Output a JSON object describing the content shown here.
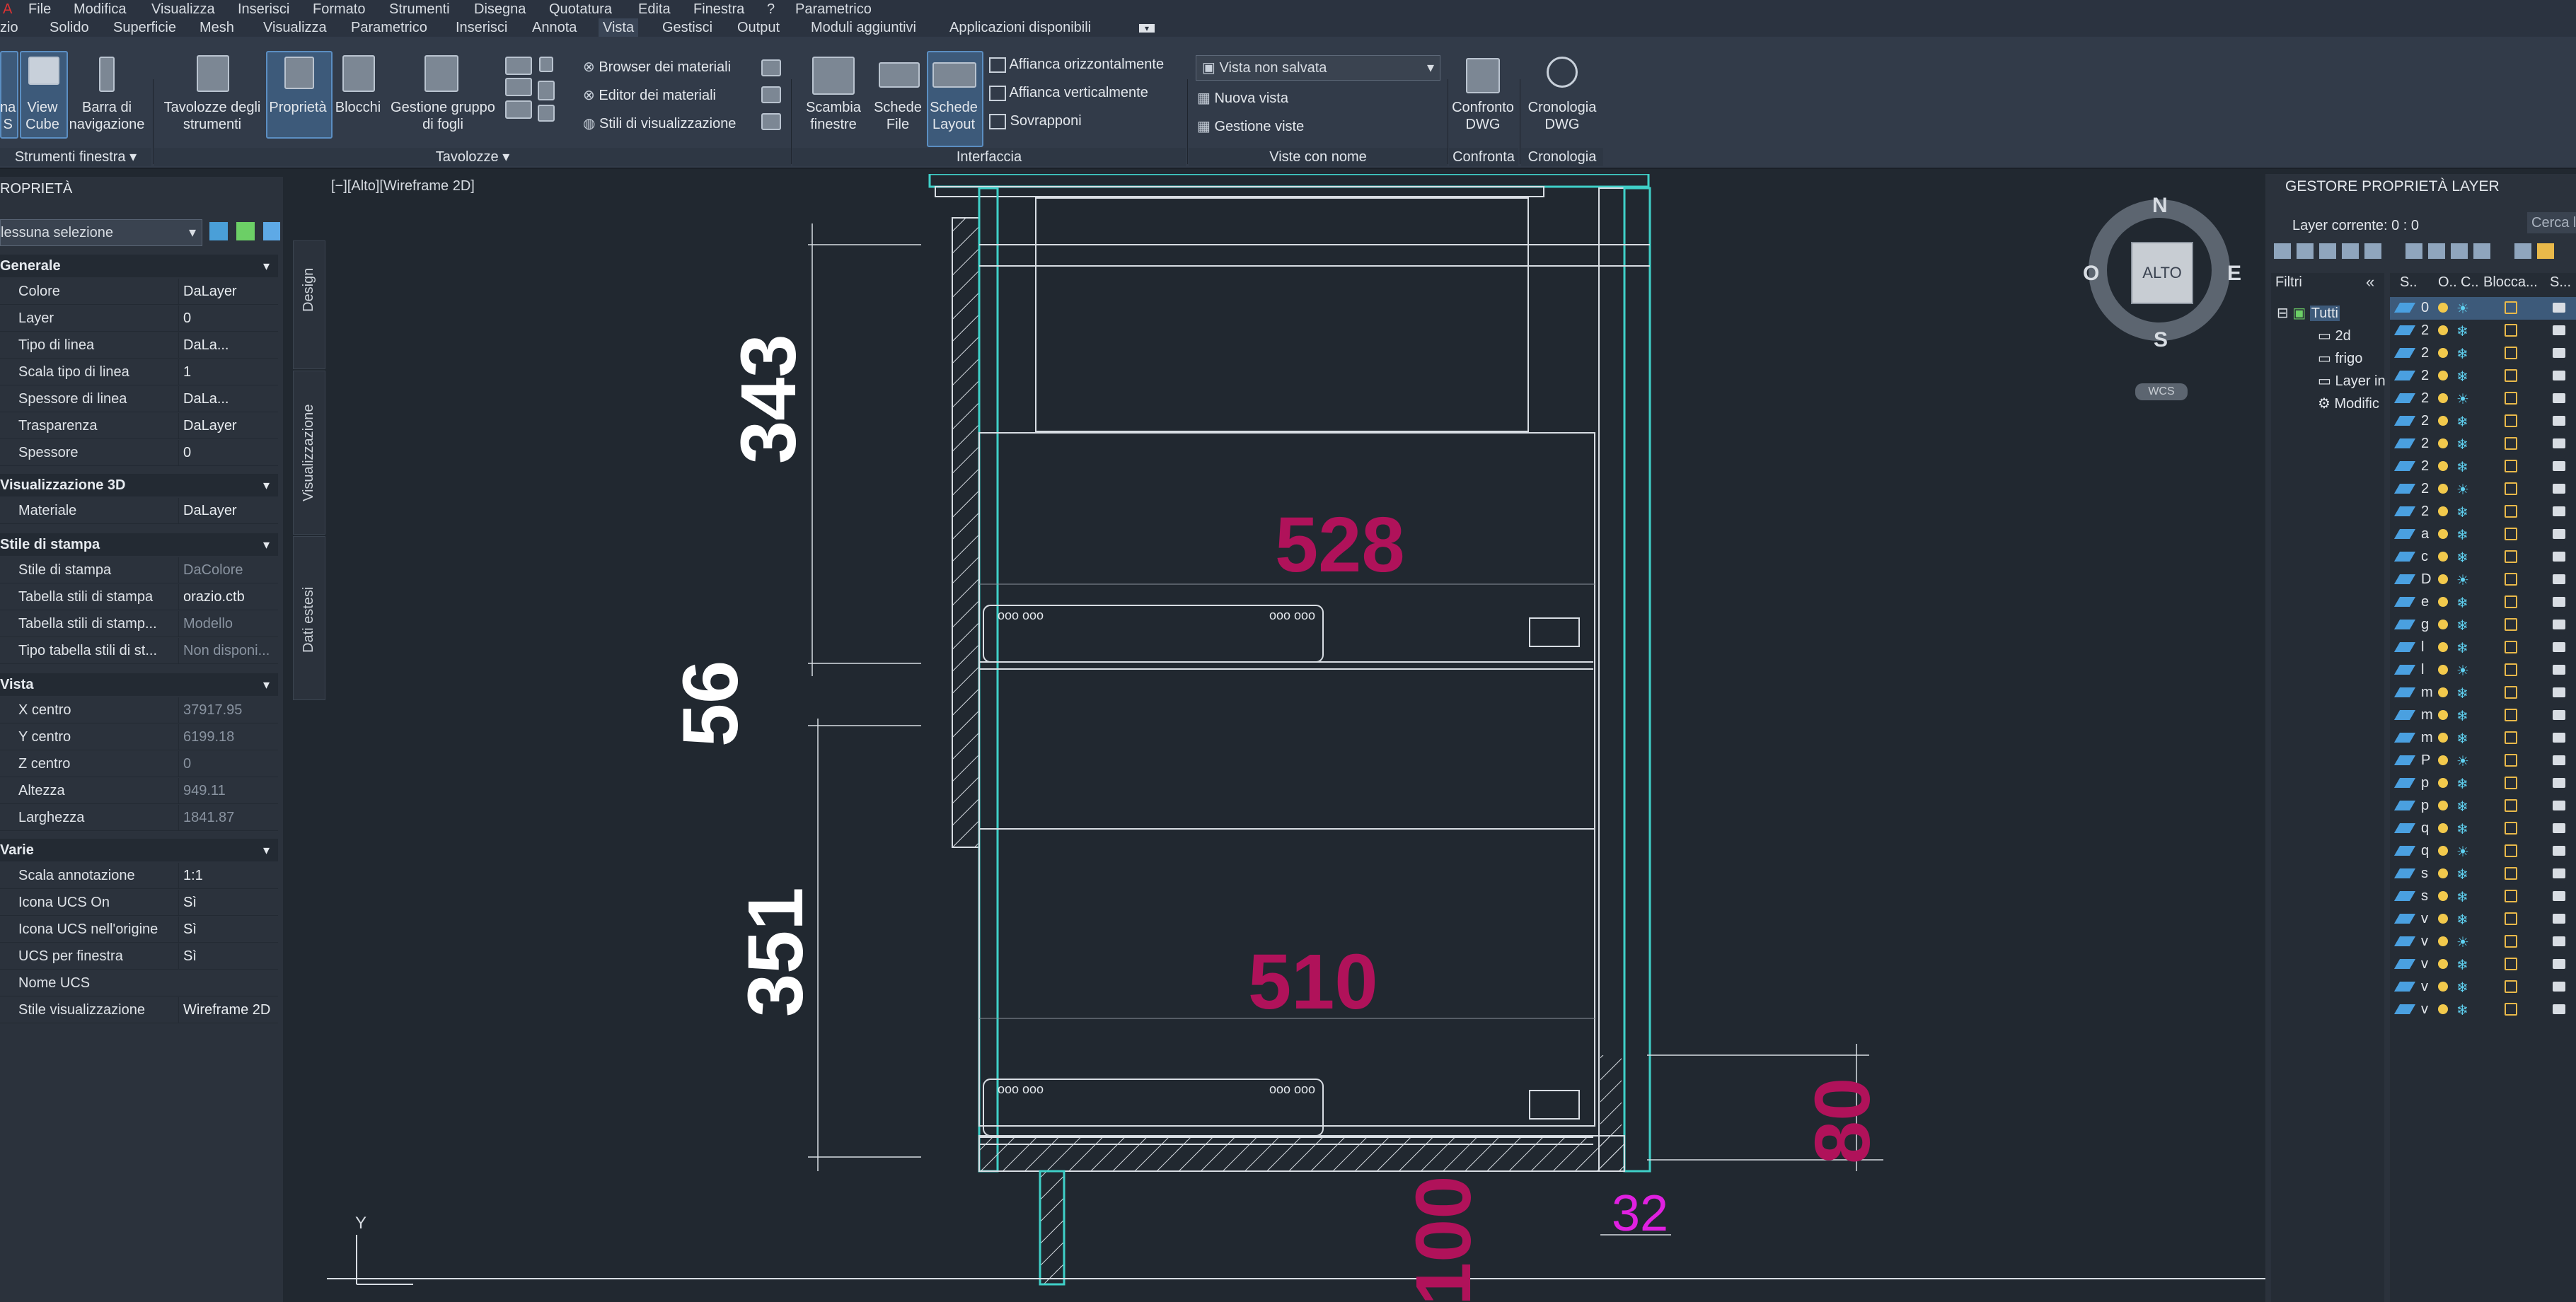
{
  "menu": [
    "File",
    "Modifica",
    "Visualizza",
    "Inserisci",
    "Formato",
    "Strumenti",
    "Disegna",
    "Quotatura",
    "Edita",
    "Finestra",
    "?",
    "Parametrico"
  ],
  "tabs": [
    "zio",
    "Solido",
    "Superficie",
    "Mesh",
    "Visualizza",
    "Parametrico",
    "Inserisci",
    "Annota",
    "Vista",
    "Gestisci",
    "Output",
    "Moduli aggiuntivi",
    "Applicazioni disponibili"
  ],
  "active_tab": "Vista",
  "ribbon": {
    "b_ucs_a": "na",
    "b_ucs_b": "S",
    "b_viewcube_a": "View",
    "b_viewcube_b": "Cube",
    "b_barra_a": "Barra di",
    "b_barra_b": "navigazione",
    "p_strumenti": "Strumenti finestra",
    "b_tav_a": "Tavolozze degli",
    "b_tav_b": "strumenti",
    "b_proprieta": "Proprietà",
    "b_blocchi": "Blocchi",
    "b_gestione_a": "Gestione gruppo",
    "b_gestione_b": "di fogli",
    "p_tavolozze": "Tavolozze",
    "s_browser": "Browser dei materiali",
    "s_editor": "Editor dei materiali",
    "s_stili": "Stili di visualizzazione",
    "b_scambia_a": "Scambia",
    "b_scambia_b": "finestre",
    "b_schede_a": "Schede",
    "b_schede_b": "File",
    "b_layout_a": "Schede",
    "b_layout_b": "Layout",
    "s_orizz": "Affianca orizzontalmente",
    "s_vert": "Affianca verticalmente",
    "s_sovr": "Sovrapponi",
    "p_interfaccia": "Interfaccia",
    "dd_vista": "Vista non salvata",
    "s_nuova": "Nuova vista",
    "s_gestione": "Gestione viste",
    "p_viste": "Viste con nome",
    "b_confronto_a": "Confronto",
    "b_confronto_b": "DWG",
    "p_confronta": "Confronta",
    "b_cron_a": "Cronologia",
    "b_cron_b": "DWG",
    "p_cronologia": "Cronologia"
  },
  "properties": {
    "title": "ROPRIETÀ",
    "selection": "lessuna selezione",
    "tabs": [
      "Design",
      "Visualizzazione",
      "Dati estesi"
    ],
    "generale_title": "Generale",
    "generale": [
      {
        "k": "Colore",
        "v": "DaLayer"
      },
      {
        "k": "Layer",
        "v": "0"
      },
      {
        "k": "Tipo di linea",
        "v": "DaLa..."
      },
      {
        "k": "Scala tipo di linea",
        "v": "1"
      },
      {
        "k": "Spessore di linea",
        "v": "DaLa..."
      },
      {
        "k": "Trasparenza",
        "v": "DaLayer"
      },
      {
        "k": "Spessore",
        "v": "0"
      }
    ],
    "vis3d_title": "Visualizzazione 3D",
    "vis3d": [
      {
        "k": "Materiale",
        "v": "DaLayer"
      }
    ],
    "stampa_title": "Stile di stampa",
    "stampa": [
      {
        "k": "Stile di stampa",
        "v": "DaColore"
      },
      {
        "k": "Tabella stili di stampa",
        "v": "orazio.ctb"
      },
      {
        "k": "Tabella stili di stamp...",
        "v": "Modello"
      },
      {
        "k": "Tipo tabella stili di st...",
        "v": "Non disponi..."
      }
    ],
    "vista_title": "Vista",
    "vista": [
      {
        "k": "X centro",
        "v": "37917.95"
      },
      {
        "k": "Y centro",
        "v": "6199.18"
      },
      {
        "k": "Z centro",
        "v": "0"
      },
      {
        "k": "Altezza",
        "v": "949.11"
      },
      {
        "k": "Larghezza",
        "v": "1841.87"
      }
    ],
    "varie_title": "Varie",
    "varie": [
      {
        "k": "Scala annotazione",
        "v": "1:1"
      },
      {
        "k": "Icona UCS On",
        "v": "Sì"
      },
      {
        "k": "Icona UCS nell'origine",
        "v": "Sì"
      },
      {
        "k": "UCS per finestra",
        "v": "Sì"
      },
      {
        "k": "Nome UCS",
        "v": ""
      },
      {
        "k": "Stile visualizzazione",
        "v": "Wireframe 2D"
      }
    ]
  },
  "viewport": {
    "label": "[−][Alto][Wireframe 2D]",
    "dims": {
      "d343": "343",
      "d56": "56",
      "d351": "351",
      "d528": "528",
      "d510": "510",
      "d80": "80",
      "d100": "100",
      "d32": "32"
    },
    "viewcube": {
      "n": "N",
      "s": "S",
      "e": "E",
      "o": "O",
      "face": "ALTO",
      "wcs": "WCS"
    },
    "ucs_y": "Y"
  },
  "layer_manager": {
    "title": "GESTORE PROPRIETÀ LAYER",
    "current": "Layer corrente: 0 : 0",
    "search": "Cerca l",
    "filters_title": "Filtri",
    "tree": [
      "Tutti",
      "2d",
      "frigo",
      "Layer in",
      "Modific"
    ],
    "headers": [
      "S..",
      "O..",
      "C..",
      "Blocca...",
      "S..."
    ],
    "layers": [
      "0",
      "2",
      "2",
      "2",
      "2",
      "2",
      "2",
      "2",
      "2",
      "2",
      "a",
      "c",
      "D",
      "e",
      "g",
      "l",
      "l",
      "m",
      "m",
      "m",
      "P",
      "p",
      "p",
      "q",
      "q",
      "s",
      "s",
      "v",
      "v",
      "v",
      "v",
      "v"
    ]
  },
  "colors": {
    "accent": "#5b8ec2",
    "dim_magenta": "#b0125a",
    "dim_white": "#ffffff",
    "geometry": "#d8dde3",
    "cyan": "#3fd0c8"
  }
}
